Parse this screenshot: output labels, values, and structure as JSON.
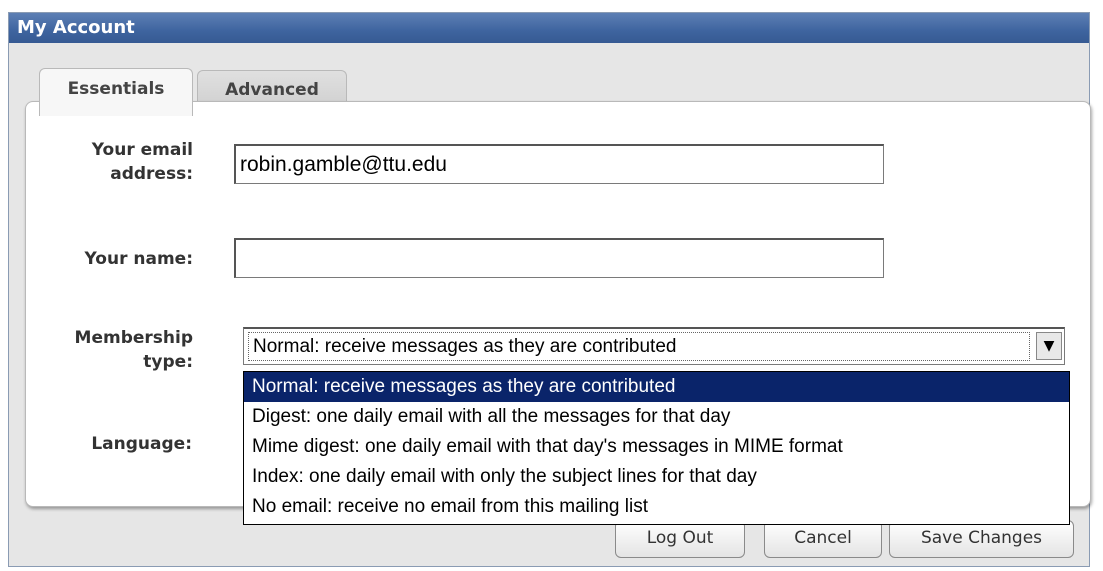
{
  "window": {
    "title": "My Account"
  },
  "tabs": [
    {
      "label": "Essentials",
      "active": true
    },
    {
      "label": "Advanced",
      "active": false
    }
  ],
  "form": {
    "email_label_line1": "Your email",
    "email_label_line2": "address:",
    "email_value": "robin.gamble@ttu.edu",
    "name_label": "Your name:",
    "name_value": "",
    "membership_label_line1": "Membership",
    "membership_label_line2": "type:",
    "membership_selected": "Normal: receive messages as they are contributed",
    "membership_options": [
      "Normal: receive messages as they are contributed",
      "Digest: one daily email with all the messages for that day",
      "Mime digest: one daily email with that day's messages in MIME format",
      "Index: one daily email with only the subject lines for that day",
      "No email: receive no email from this mailing list"
    ],
    "language_label": "Language:"
  },
  "buttons": {
    "logout": "Log Out",
    "cancel": "Cancel",
    "save": "Save Changes"
  },
  "colors": {
    "titlebar": "#3e649f",
    "selected_option_bg": "#0a246a"
  },
  "icons": {
    "dropdown_arrow": "chevron-down-icon"
  }
}
